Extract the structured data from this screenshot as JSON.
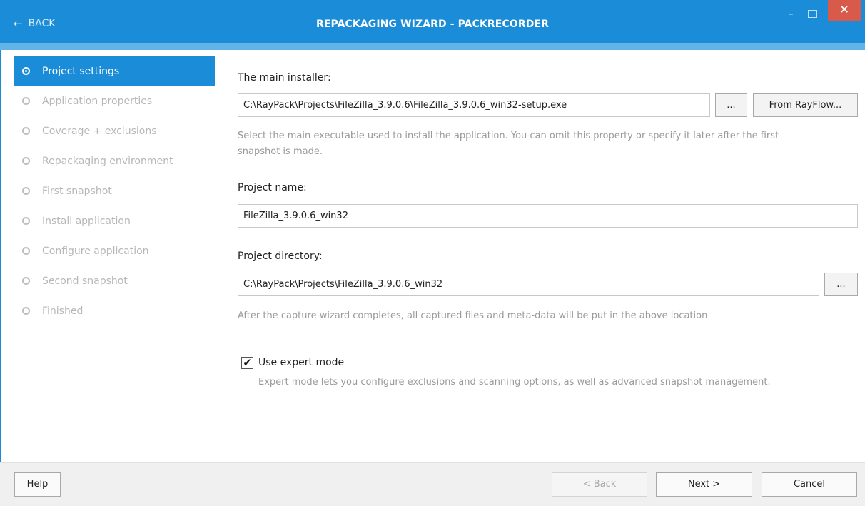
{
  "window": {
    "title": "REPACKAGING WIZARD - PACKRECORDER",
    "back_label": "BACK",
    "minimize_glyph": "–",
    "close_glyph": "✕"
  },
  "steps": [
    {
      "label": "Project settings",
      "active": true
    },
    {
      "label": "Application properties",
      "active": false
    },
    {
      "label": "Coverage + exclusions",
      "active": false
    },
    {
      "label": "Repackaging environment",
      "active": false
    },
    {
      "label": "First snapshot",
      "active": false
    },
    {
      "label": "Install application",
      "active": false
    },
    {
      "label": "Configure application",
      "active": false
    },
    {
      "label": "Second snapshot",
      "active": false
    },
    {
      "label": "Finished",
      "active": false
    }
  ],
  "form": {
    "main_installer": {
      "label": "The main installer:",
      "value": "C:\\RayPack\\Projects\\FileZilla_3.9.0.6\\FileZilla_3.9.0.6_win32-setup.exe",
      "browse_label": "...",
      "rayflow_label": "From RayFlow...",
      "hint_line1": "Select the main executable used to install the application. You can omit this property or specify it later after the first",
      "hint_line2": "snapshot is made."
    },
    "project_name": {
      "label": "Project name:",
      "value": "FileZilla_3.9.0.6_win32"
    },
    "project_directory": {
      "label": "Project directory:",
      "value": "C:\\RayPack\\Projects\\FileZilla_3.9.0.6_win32",
      "browse_label": "...",
      "hint": "After the capture wizard completes, all captured files and meta-data will be put in the above location"
    },
    "expert_mode": {
      "label": "Use expert mode",
      "checked": true,
      "check_glyph": "✔",
      "hint": "Expert mode lets you configure exclusions and scanning options, as well as advanced snapshot management."
    }
  },
  "footer": {
    "help_label": "Help",
    "back_label": "< Back",
    "next_label": "Next >",
    "cancel_label": "Cancel"
  },
  "colors": {
    "accent": "#1a8cd8",
    "accent_light": "#63b4e6",
    "close_red": "#d75a4a",
    "hint_gray": "#9a9a9a"
  }
}
